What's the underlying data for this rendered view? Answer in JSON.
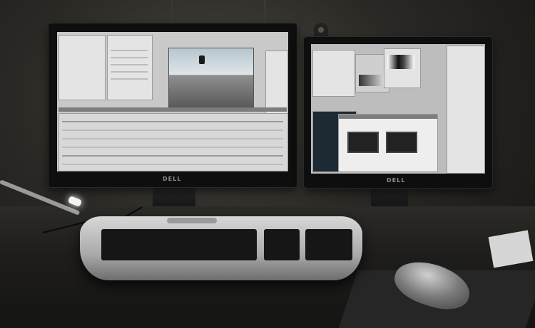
{
  "scene": {
    "description_free": true,
    "left_monitor": {
      "brand": "DELL",
      "screen": "video-editor"
    },
    "right_monitor": {
      "brand": "DELL",
      "screen": "image-editor"
    },
    "colors": {
      "wall": "#2a2824",
      "bezel": "#0e0e0e",
      "keyboard_silver": "#b9b9b9",
      "keys": "#161616"
    }
  }
}
